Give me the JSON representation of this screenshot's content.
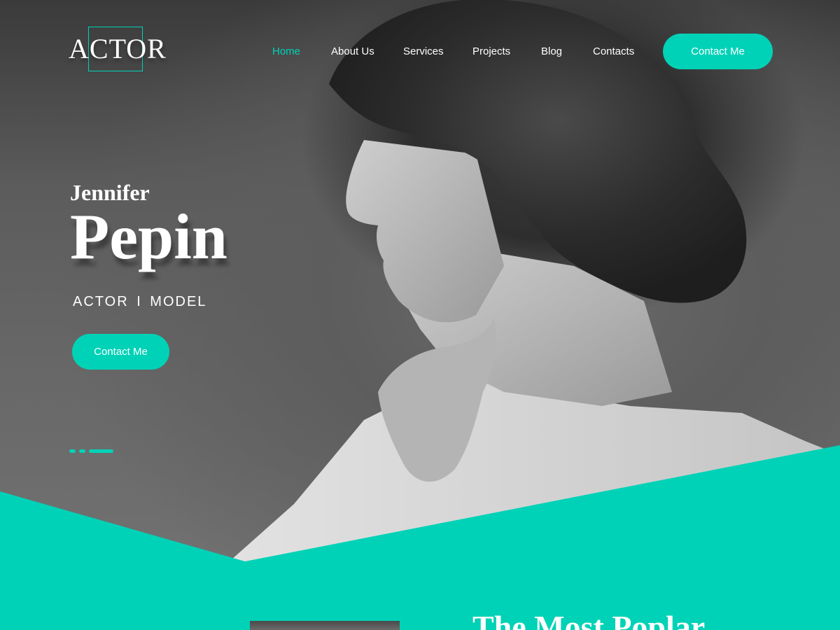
{
  "header": {
    "logo_text": "ACTOR",
    "nav": [
      {
        "label": "Home",
        "active": true
      },
      {
        "label": "About Us",
        "active": false
      },
      {
        "label": "Services",
        "active": false
      },
      {
        "label": "Projects",
        "active": false
      },
      {
        "label": "Blog",
        "active": false
      },
      {
        "label": "Contacts",
        "active": false
      }
    ],
    "cta_label": "Contact Me"
  },
  "hero": {
    "first_name": "Jennifer",
    "last_name": "Pepin",
    "subtitle": "ACTOR  I  MODEL",
    "cta_label": "Contact Me",
    "slider": {
      "slides": 3,
      "active_index": 2
    }
  },
  "next_section": {
    "title": "The Most Poplar"
  },
  "colors": {
    "accent": "#00d2b7",
    "text_light": "#ffffff",
    "photo_dark": "#2e2e2e"
  }
}
